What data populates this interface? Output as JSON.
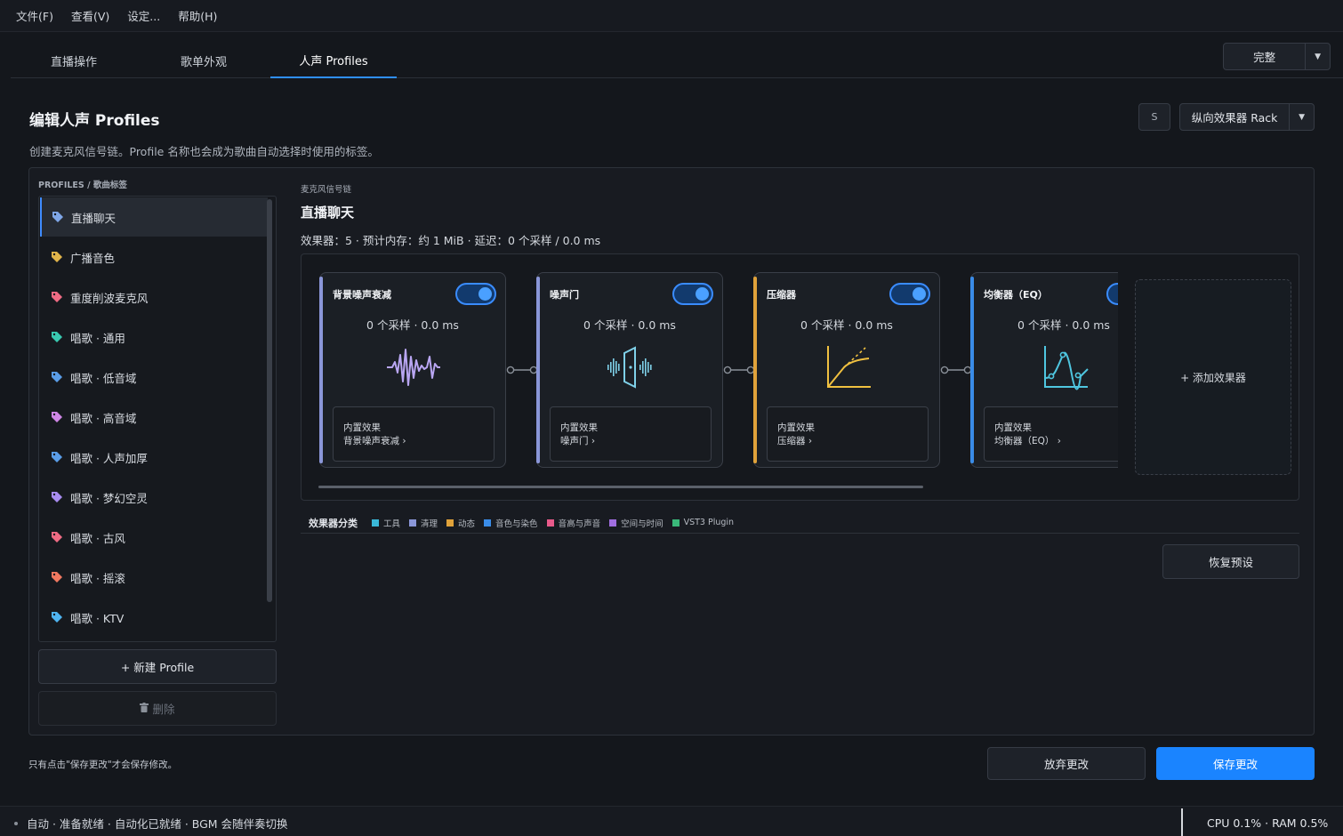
{
  "menu": [
    "文件(F)",
    "查看(V)",
    "设定...",
    "帮助(H)"
  ],
  "tabs": [
    {
      "label": "直播操作"
    },
    {
      "label": "歌单外观"
    },
    {
      "label": "人声 Profiles",
      "active": true
    }
  ],
  "done_button": {
    "label": "完整"
  },
  "page": {
    "title": "编辑人声 Profiles",
    "subtitle": "创建麦克风信号链。Profile 名称也会成为歌曲自动选择时使用的标签。"
  },
  "toolbar": {
    "s_label": "S",
    "rack_label": "纵向效果器 Rack"
  },
  "profiles": {
    "section_label": "PROFILES / 歌曲标签",
    "items": [
      {
        "label": "直播聊天",
        "color": "#7fa7e8",
        "selected": true
      },
      {
        "label": "广播音色",
        "color": "#e0b44a"
      },
      {
        "label": "重度削波麦克风",
        "color": "#ef6b84"
      },
      {
        "label": "唱歌 · 通用",
        "color": "#39c9b0"
      },
      {
        "label": "唱歌 · 低音域",
        "color": "#5a9de8"
      },
      {
        "label": "唱歌 · 高音域",
        "color": "#cf86e6"
      },
      {
        "label": "唱歌 · 人声加厚",
        "color": "#5a9de8"
      },
      {
        "label": "唱歌 · 梦幻空灵",
        "color": "#a88cf0"
      },
      {
        "label": "唱歌 · 古风",
        "color": "#ef6b84"
      },
      {
        "label": "唱歌 · 摇滚",
        "color": "#f07860"
      },
      {
        "label": "唱歌 · KTV",
        "color": "#4fb4f0"
      }
    ],
    "new_button": "+ 新建 Profile",
    "delete_button": "删除"
  },
  "chain": {
    "section_label": "麦克风信号链",
    "title": "直播聊天",
    "stats": "效果器：5 · 预计内存：约 1 MiB · 延迟：0 个采样 / 0.0 ms",
    "effects": [
      {
        "name": "背景噪声衰减",
        "stats": "0 个采样 · 0.0 ms",
        "inner_title": "内置效果",
        "inner_name": "背景噪声衰减  ›",
        "accent": "#8a96d8",
        "icon": "waveform-icon",
        "icon_color": "#b9a6f2"
      },
      {
        "name": "噪声门",
        "stats": "0 个采样 · 0.0 ms",
        "inner_title": "内置效果",
        "inner_name": "噪声门  ›",
        "accent": "#8a96d8",
        "icon": "noise-gate-icon",
        "icon_color": "#7fd0e8"
      },
      {
        "name": "压缩器",
        "stats": "0 个采样 · 0.0 ms",
        "inner_title": "内置效果",
        "inner_name": "压缩器  ›",
        "accent": "#e0a23a",
        "icon": "compressor-curve-icon",
        "icon_color": "#f0c040"
      },
      {
        "name": "均衡器（EQ）",
        "stats": "0 个采样 · 0.0 ms",
        "inner_title": "内置效果",
        "inner_name": "均衡器（EQ）  ›",
        "accent": "#3a8ce8",
        "icon": "eq-curve-icon",
        "icon_color": "#4fc6e0"
      }
    ],
    "add_effect": "+ 添加效果器"
  },
  "legend": {
    "title": "效果器分类",
    "items": [
      {
        "label": "工具",
        "color": "#3ab8d8"
      },
      {
        "label": "清理",
        "color": "#8a96d8"
      },
      {
        "label": "动态",
        "color": "#e0a23a"
      },
      {
        "label": "音色与染色",
        "color": "#3a8ce8"
      },
      {
        "label": "音高与声音",
        "color": "#e85a8a"
      },
      {
        "label": "空间与时间",
        "color": "#a06ee0"
      },
      {
        "label": "VST3 Plugin",
        "color": "#3ab87a"
      }
    ]
  },
  "restore_button": "恢复预设",
  "footer": {
    "note": "只有点击\"保存更改\"才会保存修改。",
    "discard": "放弃更改",
    "save": "保存更改"
  },
  "status": {
    "left": "自动 · 准备就绪 · 自动化已就绪 · BGM 会随伴奏切换",
    "right": "CPU 0.1% · RAM 0.5%"
  }
}
